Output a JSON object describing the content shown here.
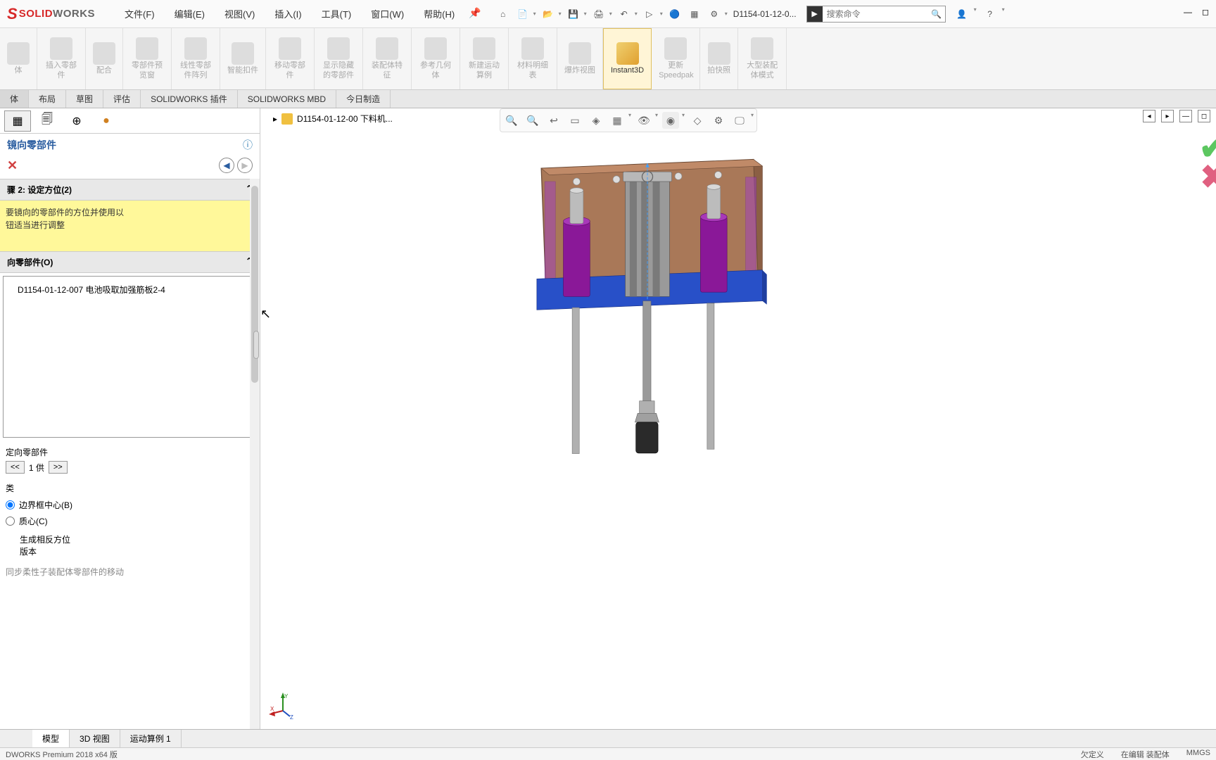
{
  "app": {
    "name_solid": "SOLID",
    "name_works": "WORKS"
  },
  "menu": [
    "文件(F)",
    "编辑(E)",
    "视图(V)",
    "插入(I)",
    "工具(T)",
    "窗口(W)",
    "帮助(H)"
  ],
  "doc_name": "D1154-01-12-0...",
  "search_placeholder": "搜索命令",
  "ribbon": [
    {
      "label": "体"
    },
    {
      "label": "插入零部件"
    },
    {
      "label": "配合"
    },
    {
      "label": "零部件预览窗"
    },
    {
      "label": "线性零部件阵列"
    },
    {
      "label": "智能扣件"
    },
    {
      "label": "移动零部件"
    },
    {
      "label": "显示隐藏的零部件"
    },
    {
      "label": "装配体特征"
    },
    {
      "label": "参考几何体"
    },
    {
      "label": "新建运动算例"
    },
    {
      "label": "材料明细表"
    },
    {
      "label": "爆炸视图"
    },
    {
      "label": "Instant3D",
      "active": true
    },
    {
      "label": "更新 Speedpak"
    },
    {
      "label": "拍快照"
    },
    {
      "label": "大型装配体模式"
    }
  ],
  "tabs": [
    "体",
    "布局",
    "草图",
    "评估",
    "SOLIDWORKS 插件",
    "SOLIDWORKS MBD",
    "今日制造"
  ],
  "pm": {
    "title": "镜向零部件",
    "cancel": "✕",
    "step_head": "骤 2: 设定方位(2)",
    "hint_l1": "要镜向的零部件的方位并使用以",
    "hint_l2": "钮适当进行调整",
    "sec2": "向零部件(O)",
    "item": "D1154-01-12-007 电池吸取加强筋板2-4",
    "orient_label": "定向零部件",
    "pager_prev": "<<",
    "pager_text": "1 供",
    "pager_next": ">>",
    "cat": "类",
    "radio1": "边界框中心(B)",
    "radio2": "质心(C)",
    "btn_l1": "生成相反方位",
    "btn_l2": "版本",
    "sync": "同步柔性子装配体零部件的移动"
  },
  "tree_node": "D1154-01-12-00 下料机...",
  "btm_tabs": [
    "模型",
    "3D 视图",
    "运动算例 1"
  ],
  "status": {
    "left": "DWORKS Premium 2018 x64 版",
    "r1": "欠定义",
    "r2": "在编辑 装配体",
    "r3": "MMGS"
  }
}
